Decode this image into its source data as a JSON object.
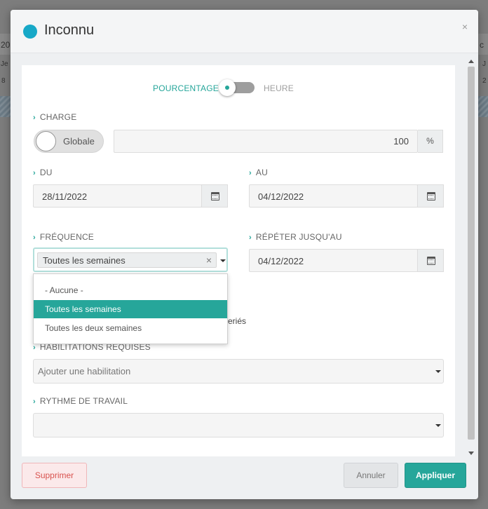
{
  "background": {
    "frag_left_1": "20",
    "frag_left_2": "Je",
    "frag_left_3": "8",
    "frag_right_1": "c",
    "frag_right_2": "J",
    "frag_right_3": "2"
  },
  "modal": {
    "title": "Inconnu",
    "title_dot_color": "#17a8c7",
    "close_label": "×"
  },
  "mode_toggle": {
    "left_label": "POURCENTAGE",
    "right_label": "HEURE",
    "active": "POURCENTAGE"
  },
  "charge": {
    "label": "CHARGE",
    "globale_label": "Globale",
    "value": "100",
    "unit": "%"
  },
  "du": {
    "label": "DU",
    "value": "28/11/2022"
  },
  "au": {
    "label": "AU",
    "value": "04/12/2022"
  },
  "frequence": {
    "label": "FRÉQUENCE",
    "selected": "Toutes les semaines",
    "clear_label": "×",
    "options": [
      "- Aucune -",
      "Toutes les semaines",
      "Toutes les deux semaines"
    ]
  },
  "repeter": {
    "label": "RÉPÉTER JUSQU'AU",
    "value": "04/12/2022"
  },
  "hidden_text": "eriés",
  "habilitations": {
    "label": "HABILITATIONS REQUISES",
    "placeholder": "Ajouter une habilitation"
  },
  "rythme": {
    "label": "RYTHME DE TRAVAIL",
    "value": ""
  },
  "footer": {
    "delete_label": "Supprimer",
    "cancel_label": "Annuler",
    "apply_label": "Appliquer"
  },
  "colors": {
    "accent": "#26a69a",
    "danger": "#d9534f"
  }
}
